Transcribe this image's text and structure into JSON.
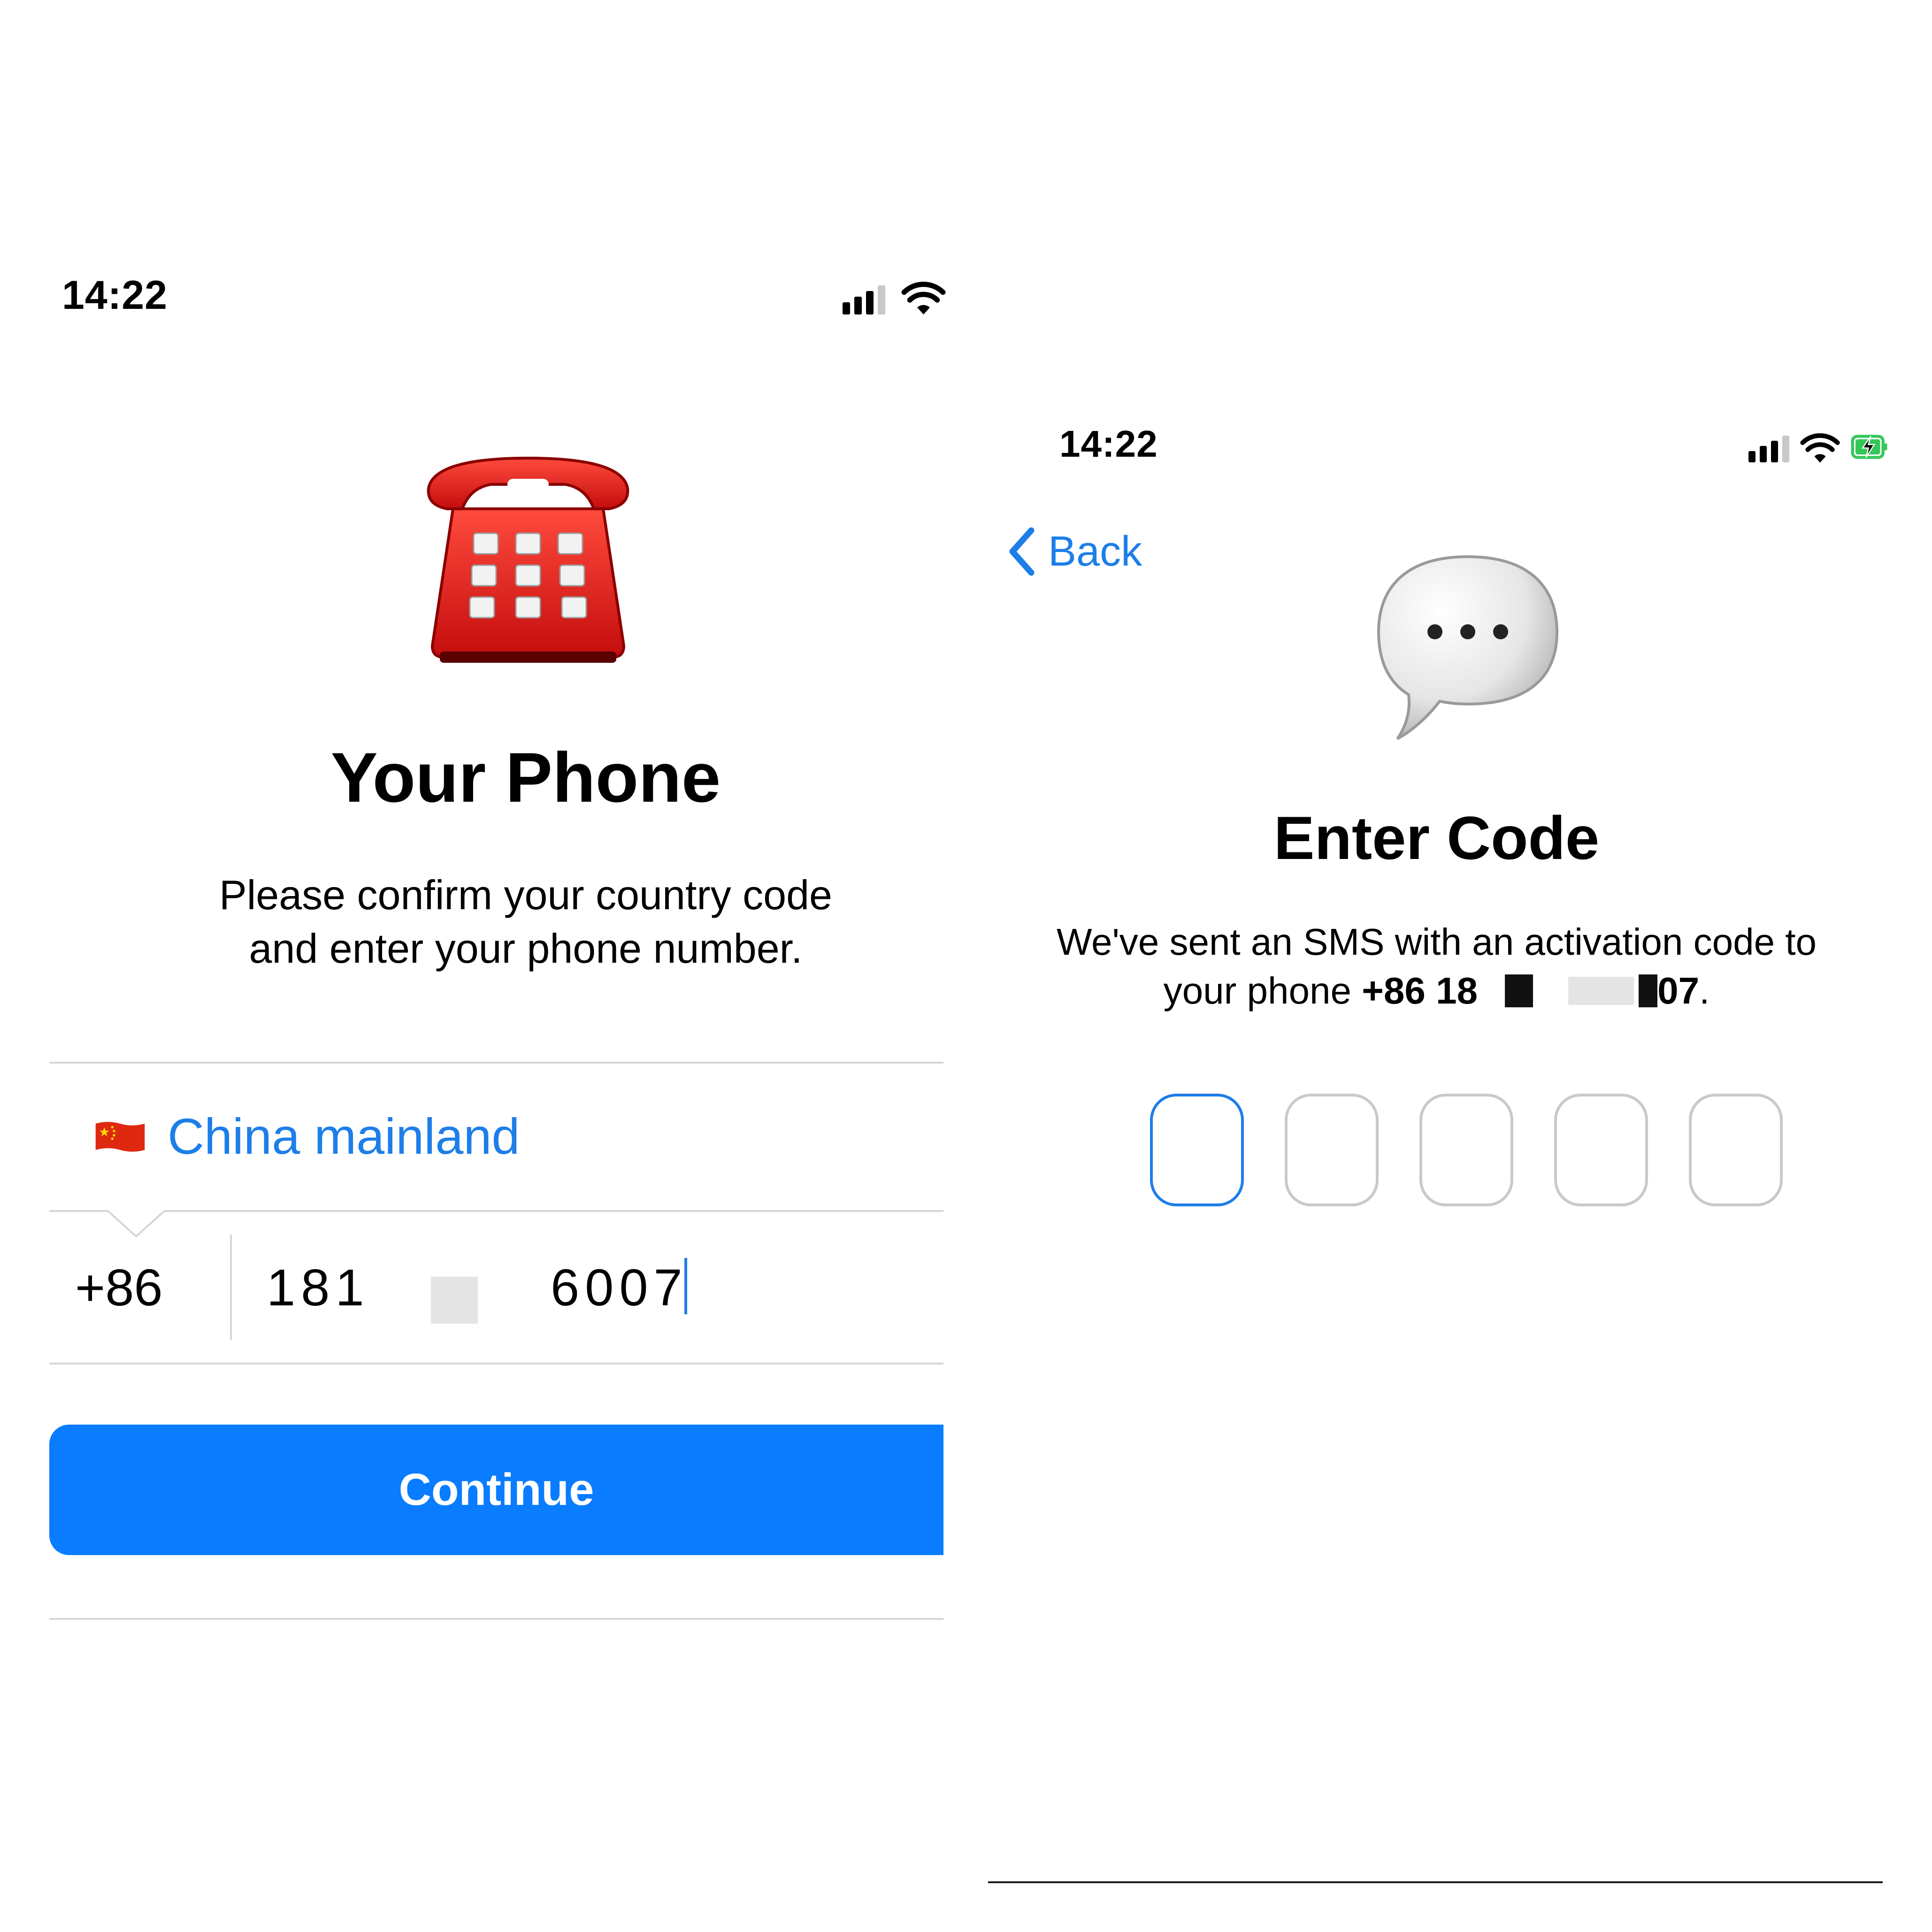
{
  "left_screen": {
    "status_bar": {
      "time": "14:22",
      "icons": [
        "cellular-signal-icon",
        "wifi-icon"
      ]
    },
    "hero_icon": "telephone-icon",
    "title": "Your Phone",
    "subtitle_line1": "Please confirm your country code",
    "subtitle_line2": "and enter your phone number.",
    "country": {
      "flag": "🇨🇳",
      "name": "China mainland"
    },
    "phone": {
      "country_code": "+86",
      "number_start": "181",
      "number_end": "6007"
    },
    "continue_label": "Continue"
  },
  "right_screen": {
    "status_bar": {
      "time": "14:22",
      "icons": [
        "cellular-signal-icon",
        "wifi-icon",
        "battery-charging-icon"
      ]
    },
    "back_label": "Back",
    "hero_icon": "speech-bubble-icon",
    "title": "Enter Code",
    "message_line1": "We've sent an SMS with an activation code to",
    "message_line2_prefix": "your phone ",
    "phone_start": "+86 18",
    "phone_end": "07",
    "phone_suffix": ".",
    "code_boxes": 5
  },
  "colors": {
    "accent": "#1d7ee8",
    "button": "#0a7cff",
    "separator": "#d6d6d6"
  }
}
